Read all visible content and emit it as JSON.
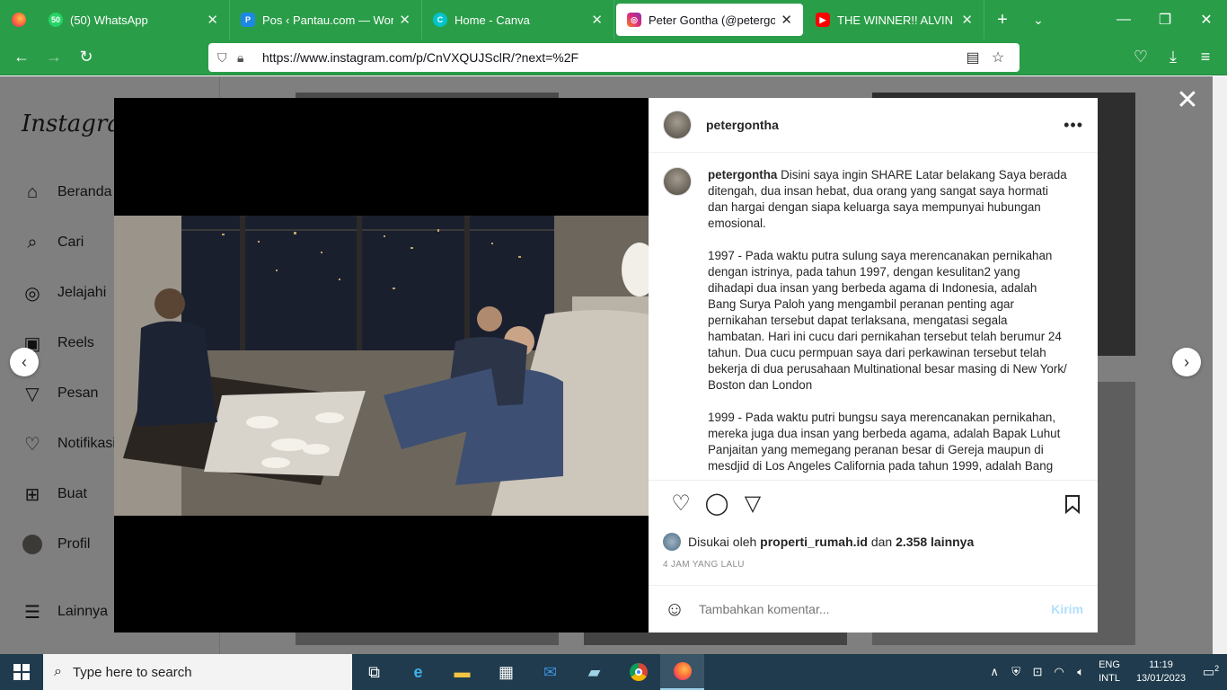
{
  "browser": {
    "tabs": [
      {
        "title": "(50) WhatsApp",
        "fav_color": "#25d366",
        "active": false
      },
      {
        "title": "Pos ‹ Pantau.com — WordPress",
        "fav_color": "#1e88e5",
        "active": false
      },
      {
        "title": "Home - Canva",
        "fav_color": "#00c4cc",
        "active": false
      },
      {
        "title": "Peter Gontha (@petergontha)",
        "fav_color": "#e1306c",
        "active": true
      },
      {
        "title": "THE WINNER!! ALVIN SANG JA",
        "fav_color": "#ff0000",
        "active": false
      }
    ],
    "url": "https://www.instagram.com/p/CnVXQUJSclR/?next=%2F"
  },
  "sidebar": {
    "logo": "Instagram",
    "items": [
      {
        "label": "Beranda",
        "icon": "home-icon"
      },
      {
        "label": "Cari",
        "icon": "search-icon"
      },
      {
        "label": "Jelajahi",
        "icon": "compass-icon"
      },
      {
        "label": "Reels",
        "icon": "reels-icon"
      },
      {
        "label": "Pesan",
        "icon": "paper-plane-icon"
      },
      {
        "label": "Notifikasi",
        "icon": "heart-icon"
      },
      {
        "label": "Buat",
        "icon": "plus-square-icon"
      },
      {
        "label": "Profil",
        "icon": "profile-avatar"
      },
      {
        "label": "Lainnya",
        "icon": "menu-icon"
      }
    ]
  },
  "post": {
    "username": "petergontha",
    "caption_paragraphs": [
      "Disini saya ingin SHARE Latar belakang Saya berada ditengah, dua insan hebat, dua orang yang sangat saya hormati dan hargai dengan siapa keluarga saya mempunyai hubungan emosional.",
      "1997 - Pada waktu putra sulung saya merencanakan pernikahan dengan istrinya, pada tahun 1997, dengan kesulitan2 yang dihadapi dua insan yang berbeda agama di Indonesia, adalah Bang Surya Paloh yang mengambil peranan penting agar pernikahan tersebut dapat terlaksana, mengatasi segala hambatan. Hari ini cucu dari pernikahan tersebut telah berumur 24 tahun. Dua cucu permpuan saya dari perkawinan tersebut telah bekerja di dua perusahaan Multinational besar masing di New York/ Boston dan London",
      "1999 - Pada waktu putri bungsu saya merencanakan pernikahan, mereka juga dua insan yang berbeda agama, adalah Bapak Luhut Panjaitan yang memegang peranan besar di Gereja maupun di mesdjid di Los Angeles California pada tahun 1999, adalah Bang"
    ],
    "liked_by_prefix": "Disukai oleh",
    "liked_by_user": "properti_rumah.id",
    "liked_by_middle": "dan",
    "liked_by_count": "2.358 lainnya",
    "time_ago": "4 JAM YANG LALU",
    "comment_placeholder": "Tambahkan komentar...",
    "post_button": "Kirim"
  },
  "taskbar": {
    "search_placeholder": "Type here to search",
    "lang_line1": "ENG",
    "lang_line2": "INTL",
    "time": "11:19",
    "date": "13/01/2023",
    "notifications": "2"
  }
}
